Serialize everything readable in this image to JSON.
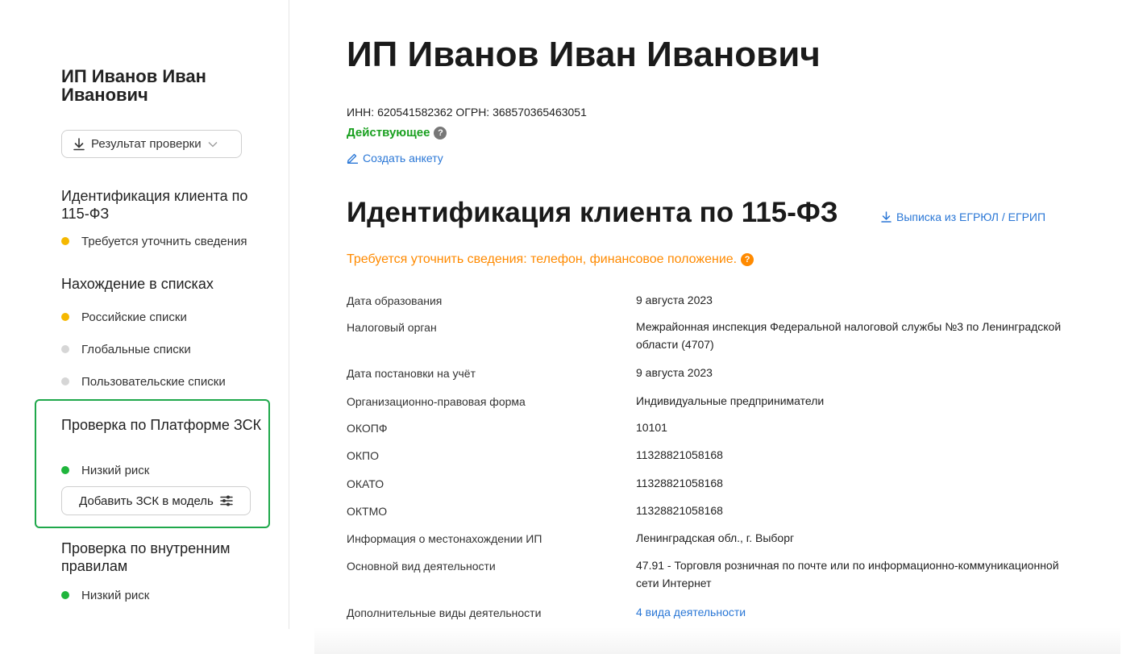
{
  "sidebar": {
    "title": "ИП Иванов Иван Иванович",
    "result_button": "Результат проверки",
    "sections": [
      {
        "title": "Идентификация клиента по 115-ФЗ",
        "items": [
          {
            "label": "Требуется уточнить сведения",
            "status_color": "#f5b800"
          }
        ]
      },
      {
        "title": "Нахождение в списках",
        "items": [
          {
            "label": "Российские списки",
            "status_color": "#f5b800"
          },
          {
            "label": "Глобальные списки",
            "status_color": "#d6d6d6"
          },
          {
            "label": "Пользовательские списки",
            "status_color": "#d6d6d6"
          }
        ]
      },
      {
        "title": "Проверка по Платформе ЗСК",
        "items": [
          {
            "label": "Низкий риск",
            "status_color": "#1fb53c"
          }
        ],
        "button": "Добавить ЗСК в модель"
      },
      {
        "title": "Проверка по внутренним правилам",
        "items": [
          {
            "label": "Низкий риск",
            "status_color": "#1fb53c"
          }
        ]
      }
    ]
  },
  "main": {
    "title": "ИП Иванов Иван Иванович",
    "ids": "ИНН: 620541582362 ОГРН: 368570365463051",
    "status": "Действующее",
    "create_link": "Создать анкету",
    "section_title": "Идентификация клиента по 115-ФЗ",
    "egrul_link": "Выписка из ЕГРЮЛ / ЕГРИП",
    "warning": "Требуется уточнить сведения: телефон, финансовое положение.",
    "rows": [
      {
        "label": "Дата образования",
        "value": "9 августа 2023"
      },
      {
        "label": "Налоговый орган",
        "value": "Межрайонная инспекция Федеральной налоговой службы №3 по Ленинградской области (4707)"
      },
      {
        "label": "Дата постановки на учёт",
        "value": "9 августа 2023"
      },
      {
        "label": "Организационно-правовая форма",
        "value": "Индивидуальные предприниматели"
      },
      {
        "label": "ОКОПФ",
        "value": "10101"
      },
      {
        "label": "ОКПО",
        "value": "11328821058168"
      },
      {
        "label": "ОКАТО",
        "value": "11328821058168"
      },
      {
        "label": "ОКТМО",
        "value": "11328821058168"
      },
      {
        "label": "Информация о местонахождении ИП",
        "value": "Ленинградская обл., г. Выборг"
      },
      {
        "label": "Основной вид деятельности",
        "value": "47.91 - Торговля розничная по почте или по информационно-коммуникационной сети Интернет"
      },
      {
        "label": "Дополнительные виды деятельности",
        "value": "4 вида деятельности"
      }
    ]
  },
  "colors": {
    "accent_link": "#2a77d6",
    "active_green": "#1aa020",
    "warning_orange": "#ff8a00",
    "highlight_border": "#1fa84b"
  }
}
